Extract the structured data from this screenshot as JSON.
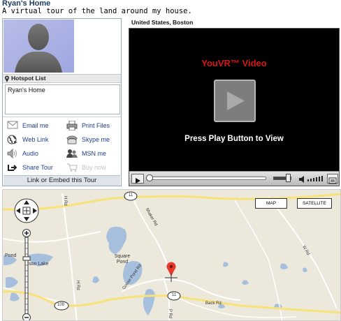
{
  "tour": {
    "title": "Ryan's Home",
    "description": "A virtual tour of the land around my house."
  },
  "hotspots": {
    "header": "Hotspot List",
    "items": [
      "Ryan's Home"
    ]
  },
  "actions": {
    "email": "Email me",
    "print": "Print Files",
    "weblink": "Web Link",
    "skype": "Skype me",
    "audio": "Audio",
    "msn": "MSN me",
    "share": "Share Tour",
    "buy": "Buy now",
    "embed": "Link or Embed this Tour"
  },
  "video": {
    "location": "United States, Boston",
    "title": "YouVR™ Video",
    "message": "Press Play Button to View"
  },
  "map": {
    "map_button": "MAP",
    "satellite_button": "SATELLITE",
    "labels": {
      "route11_top": "11",
      "route11_bottom": "11",
      "route109": "109",
      "h_rd_top": "H Rd",
      "h_rd_bottom": "H Rd",
      "shaker": "Shaker Rd",
      "w_rd": "W Rd",
      "square_pond": "Square Pond",
      "pond": "Pond",
      "lake": "ilson Lake",
      "goose": "Goose Pond Rd",
      "back": "Back Rd",
      "p_rd": "P Rd"
    }
  },
  "colors": {
    "title_blue": "#1a3b5c",
    "link_blue": "#1f3f8f",
    "video_title_red": "#d81515",
    "water": "#a5bfdd",
    "map_bg": "#ece8dc",
    "highway": "#f7e27a",
    "marker": "#e83a2c"
  }
}
